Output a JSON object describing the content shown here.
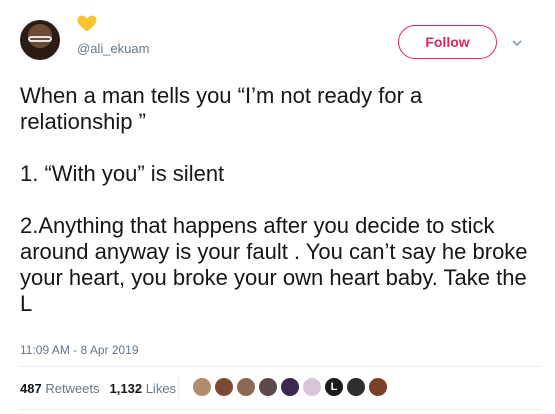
{
  "user": {
    "handle": "@ali_ekuam",
    "follow_label": "Follow"
  },
  "tweet": {
    "line1": "When a man tells you “I’m not ready for a relationship ”",
    "line2": "1. “With you” is silent",
    "line3": "2.Anything that happens after you decide to stick around anyway is your fault . You can’t say he broke your heart, you broke your own heart baby. Take the L"
  },
  "meta": {
    "timestamp": "11:09 AM - 8 Apr 2019"
  },
  "stats": {
    "retweets_count": "487",
    "retweets_label": "Retweets",
    "likes_count": "1,132",
    "likes_label": "Likes"
  },
  "likers": [
    {
      "icon": "avatar",
      "color": "#b08d6e"
    },
    {
      "icon": "avatar",
      "color": "#7a4b32"
    },
    {
      "icon": "avatar",
      "color": "#8a6a52"
    },
    {
      "icon": "avatar",
      "color": "#5b4a4a"
    },
    {
      "icon": "avatar",
      "color": "#3a2a50"
    },
    {
      "icon": "avatar",
      "color": "#d8c6d8"
    },
    {
      "icon": "avatar",
      "color": "#1b1b1b",
      "letter": "L"
    },
    {
      "icon": "avatar",
      "color": "#2d2d2d"
    },
    {
      "icon": "avatar",
      "color": "#7b3f2a"
    }
  ],
  "colors": {
    "accent": "#e0245e",
    "heart": "#f7c32e",
    "muted": "#657786"
  }
}
